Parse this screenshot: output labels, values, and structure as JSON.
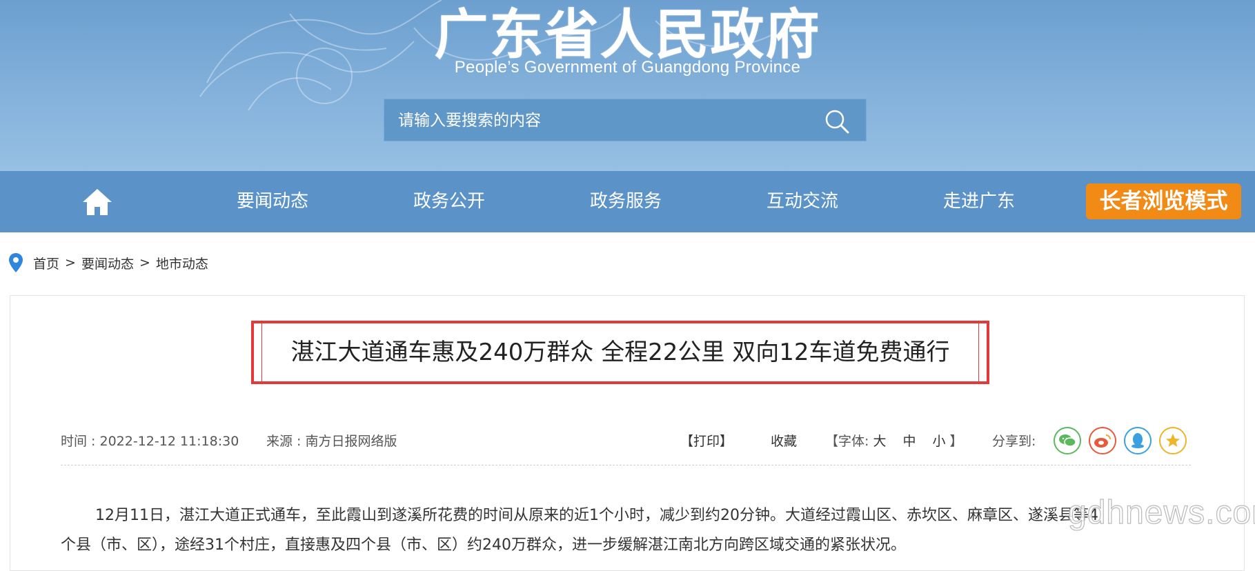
{
  "header": {
    "title": "广东省人民政府",
    "subtitle": "People’s Government of Guangdong Province",
    "search": {
      "placeholder": "请输入要搜索的内容",
      "icon": "search-icon"
    }
  },
  "nav": {
    "home_icon": "home-icon",
    "items": [
      "要闻动态",
      "政务公开",
      "政务服务",
      "互动交流",
      "走进广东"
    ],
    "elder_mode": "长者浏览模式"
  },
  "breadcrumb": {
    "icon": "location-pin-icon",
    "items": [
      "首页",
      "要闻动态",
      "地市动态"
    ],
    "separator": ">"
  },
  "article": {
    "title": "湛江大道通车惠及240万群众 全程22公里 双向12车道免费通行",
    "time_label": "时间 : ",
    "time_value": "2022-12-12 11:18:30",
    "source_label": "来源 : ",
    "source_value": "南方日报网络版",
    "print": "【打印】",
    "favorite": "收藏",
    "font_label": "【字体: ",
    "font_large": "大",
    "font_medium": "中",
    "font_small": "小",
    "font_close": " 】",
    "share_label": "分享到:",
    "share_icons": [
      "wechat-icon",
      "weibo-icon",
      "qq-icon",
      "qzone-star-icon"
    ],
    "paragraph_line1": "12月11日，湛江大道正式通车，至此霞山到遂溪所花费的时间从原来的近1个小时，减少到约20分钟。大道经过霞山区、赤坎区、麻章区、遂溪县等4",
    "paragraph_line2": "个县（市、区），途经31个村庄，直接惠及四个县（市、区）约240万群众，进一步缓解湛江南北方向跨区域交通的紧张状况。"
  },
  "watermark": "gdhnews.com",
  "colors": {
    "banner": "#86b3dc",
    "nav": "#5b93c9",
    "elder_button": "#f28a16",
    "title_border": "#e53939"
  }
}
